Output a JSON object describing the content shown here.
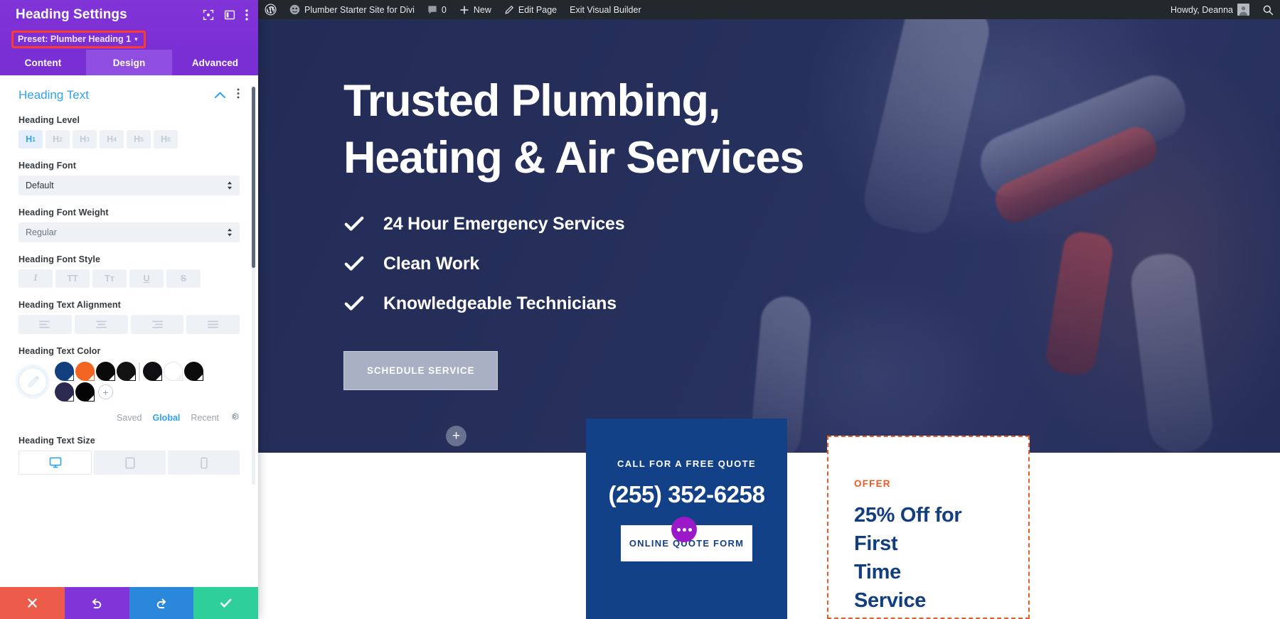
{
  "adminbar": {
    "wp_logo": "wordpress-logo-icon",
    "site_name": "Plumber Starter Site for Divi",
    "comments_count": "0",
    "new_label": "New",
    "edit_page_label": "Edit Page",
    "exit_builder_label": "Exit Visual Builder",
    "howdy": "Howdy, Deanna",
    "search": "search-icon"
  },
  "panel": {
    "title": "Heading Settings",
    "preset_label": "Preset: Plumber Heading 1",
    "preset_caret": "▾",
    "tabs": [
      {
        "label": "Content",
        "active": false
      },
      {
        "label": "Design",
        "active": true
      },
      {
        "label": "Advanced",
        "active": false
      }
    ],
    "section": {
      "title": "Heading Text"
    },
    "fields": {
      "heading_level": {
        "label": "Heading Level",
        "options": [
          "H1",
          "H2",
          "H3",
          "H4",
          "H5",
          "H6"
        ],
        "levels": [
          "1",
          "2",
          "3",
          "4",
          "5",
          "6"
        ],
        "active_index": 0
      },
      "heading_font": {
        "label": "Heading Font",
        "value": "Default"
      },
      "heading_font_weight": {
        "label": "Heading Font Weight",
        "value": "Regular"
      },
      "heading_font_style": {
        "label": "Heading Font Style",
        "options": [
          "I",
          "TT",
          "Tᴛ",
          "U",
          "S"
        ]
      },
      "heading_text_alignment": {
        "label": "Heading Text Alignment",
        "options": [
          "align-left",
          "align-center",
          "align-right",
          "align-justify"
        ]
      },
      "heading_text_color": {
        "label": "Heading Text Color",
        "eyedropper": "eyedropper-icon",
        "swatches": [
          "#12407f",
          "#f26522",
          "#0a0a0a",
          "#131313",
          "divider",
          "#0e0e14",
          "#ffffff",
          "#0c0c0c",
          "#2b2b52",
          "#050505"
        ],
        "add_label": "+",
        "palette_tabs": [
          {
            "label": "Saved",
            "active": false
          },
          {
            "label": "Global",
            "active": true
          },
          {
            "label": "Recent",
            "active": false
          }
        ],
        "settings_icon": "gear-icon"
      },
      "heading_text_size": {
        "label": "Heading Text Size",
        "devices": [
          "desktop-icon",
          "tablet-icon",
          "phone-icon"
        ],
        "active_index": 0
      }
    },
    "footer": {
      "cancel": "close-icon",
      "undo": "undo-icon",
      "redo": "redo-icon",
      "save": "check-icon"
    }
  },
  "page": {
    "hero": {
      "heading_line1": "Trusted Plumbing,",
      "heading_line2": "Heating & Air Services",
      "bullets": [
        "24 Hour Emergency Services",
        "Clean Work",
        "Knowledgeable Technicians"
      ],
      "cta_label": "SCHEDULE SERVICE",
      "add_row_label": "+"
    },
    "quote_card": {
      "label": "CALL FOR A FREE QUOTE",
      "phone": "(255) 352-6258",
      "form_button": "ONLINE QUOTE FORM"
    },
    "offer_card": {
      "kicker": "OFFER",
      "title_line1": "25% Off for First",
      "title_line2": "Time",
      "title_line3": "Service"
    },
    "module_menu": "module-options-icon"
  },
  "colors": {
    "divi_purple": "#7a2fd4",
    "accent_blue": "#2ea3f2",
    "hero_navy": "#232d57",
    "card_blue": "#124187",
    "offer_orange": "#ee5a24",
    "highlight_red": "#ff3b30"
  }
}
